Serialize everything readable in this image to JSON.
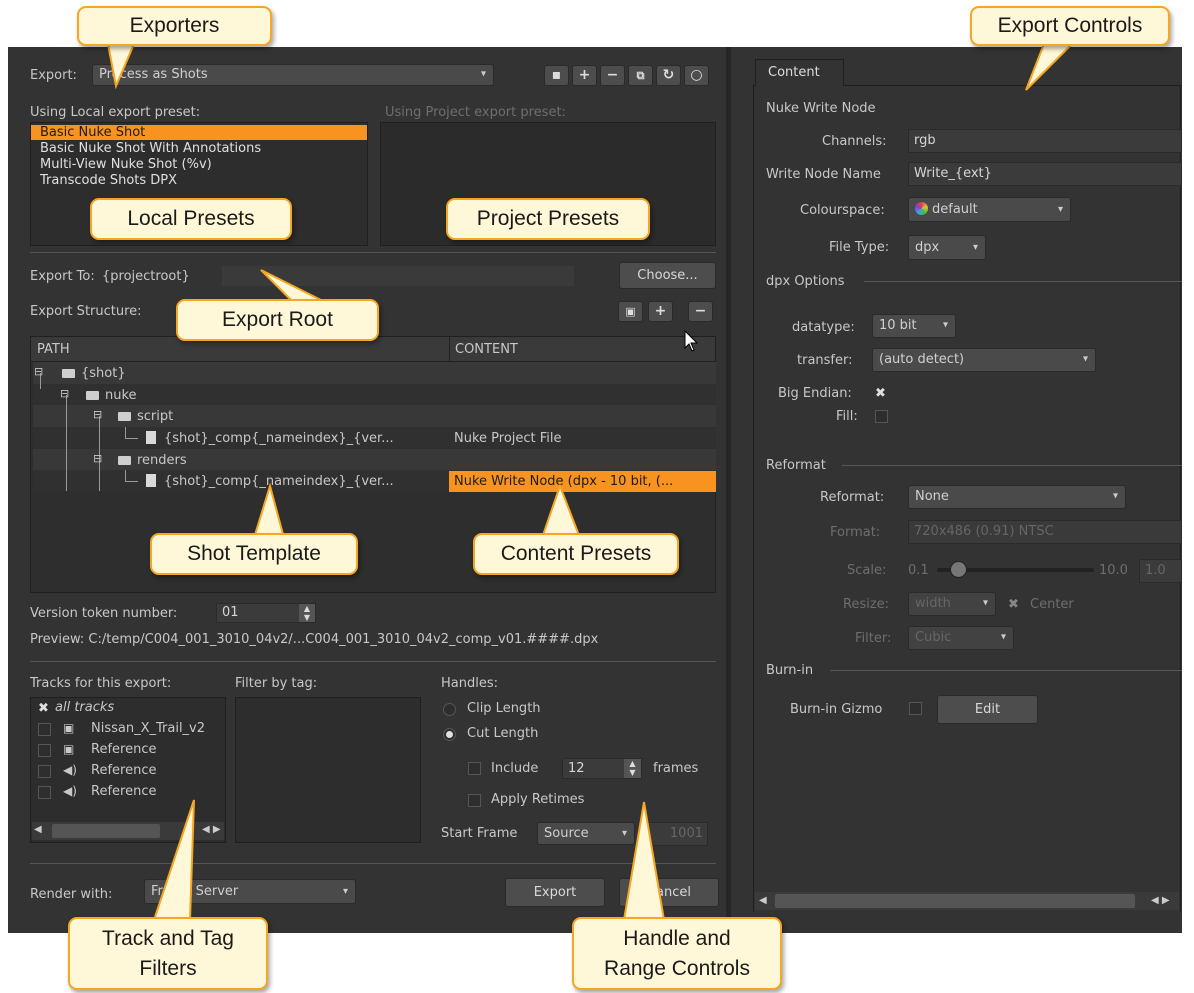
{
  "exporters": {
    "export_label": "Export:",
    "export_value": "Process as Shots",
    "local_preset_label": "Using Local export preset:",
    "project_preset_label": "Using Project export preset:",
    "local_presets": [
      "Basic Nuke Shot",
      "Basic Nuke Shot With Annotations",
      "Multi-View Nuke Shot (%v)",
      "Transcode Shots DPX"
    ],
    "selected_preset_index": 0
  },
  "export_to": {
    "label": "Export To:",
    "value": "{projectroot}",
    "choose_button": "Choose...",
    "structure_label": "Export Structure:"
  },
  "structure_table": {
    "headers": [
      "PATH",
      "CONTENT"
    ],
    "rows": [
      {
        "path": "{shot}",
        "content": ""
      },
      {
        "path": "nuke",
        "content": ""
      },
      {
        "path": "script",
        "content": ""
      },
      {
        "path": "{shot}_comp{_nameindex}_{ver...",
        "content": "Nuke Project File"
      },
      {
        "path": "renders",
        "content": ""
      },
      {
        "path": "{shot}_comp{_nameindex}_{ver...",
        "content": "Nuke Write Node (dpx - 10 bit, (..."
      }
    ]
  },
  "version": {
    "label": "Version token number:",
    "value": "01",
    "preview": "Preview: C:/temp/C004_001_3010_04v2/...C004_001_3010_04v2_comp_v01.####.dpx"
  },
  "tracks": {
    "label": "Tracks for this export:",
    "items": [
      {
        "name": "all tracks",
        "checked": true,
        "icon": ""
      },
      {
        "name": "Nissan_X_Trail_v2",
        "checked": false,
        "icon": "monitor-icon"
      },
      {
        "name": "Reference",
        "checked": false,
        "icon": "monitor-icon"
      },
      {
        "name": "Reference",
        "checked": false,
        "icon": "speaker-icon"
      },
      {
        "name": "Reference",
        "checked": false,
        "icon": "speaker-icon"
      }
    ],
    "filter_label": "Filter by tag:"
  },
  "handles": {
    "label": "Handles:",
    "clip_length": "Clip Length",
    "cut_length": "Cut Length",
    "include": "Include",
    "include_value": "12",
    "frames": "frames",
    "apply_retimes": "Apply Retimes",
    "start_frame_label": "Start Frame",
    "start_frame_value": "Source",
    "start_frame_number": "1001"
  },
  "render": {
    "label": "Render with:",
    "value": "Frame Server",
    "export_button": "Export",
    "cancel_button": "Cancel"
  },
  "content": {
    "tab": "Content",
    "section_title": "Nuke Write Node",
    "channels_label": "Channels:",
    "channels_value": "rgb",
    "write_node_name_label": "Write Node Name",
    "write_node_name_value": "Write_{ext}",
    "colourspace_label": "Colourspace:",
    "colourspace_value": "default",
    "file_type_label": "File Type:",
    "file_type_value": "dpx",
    "dpx_options": "dpx Options",
    "datatype_label": "datatype:",
    "datatype_value": "10 bit",
    "transfer_label": "transfer:",
    "transfer_value": "(auto detect)",
    "big_endian_label": "Big Endian:",
    "fill_label": "Fill:",
    "reformat_section": "Reformat",
    "reformat_label": "Reformat:",
    "reformat_value": "None",
    "format_label": "Format:",
    "format_value": "720x486 (0.91) NTSC",
    "scale_label": "Scale:",
    "scale_min": "0.1",
    "scale_max": "10.0",
    "scale_value": "1.0",
    "resize_label": "Resize:",
    "resize_value": "width",
    "center_label": "Center",
    "filter_label": "Filter:",
    "filter_value": "Cubic",
    "burnin_section": "Burn-in",
    "burnin_gizmo_label": "Burn-in Gizmo",
    "edit_button": "Edit"
  },
  "callouts": {
    "exporters": "Exporters",
    "export_controls": "Export Controls",
    "local_presets": "Local Presets",
    "project_presets": "Project Presets",
    "export_root": "Export Root",
    "shot_template": "Shot Template",
    "content_presets": "Content Presets",
    "track_tag_filters": "Track and Tag Filters",
    "handle_range_controls": "Handle and Range Controls"
  },
  "colors": {
    "panel_bg": "#333333",
    "selection": "#f7931e",
    "callout_border": "#f5a623",
    "callout_fill": "#fff8d8"
  }
}
